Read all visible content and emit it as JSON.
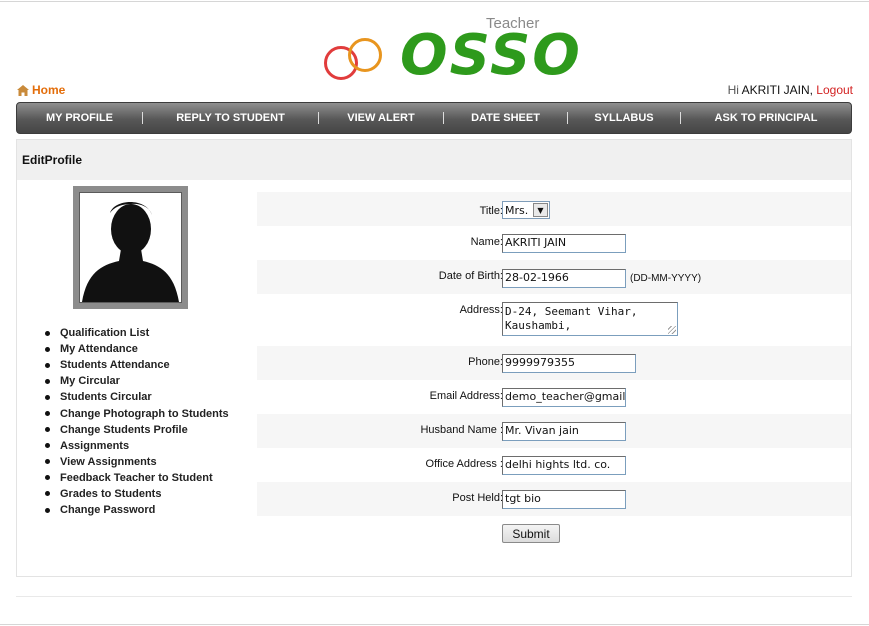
{
  "header": {
    "logo_subtitle": "Teacher",
    "logo_text": "OSSO",
    "home_label": "Home",
    "greeting": "Hi",
    "user_name": "AKRITI JAIN,",
    "logout_label": "Logout"
  },
  "nav": {
    "items": [
      {
        "label": "MY PROFILE"
      },
      {
        "label": "REPLY TO STUDENT"
      },
      {
        "label": "VIEW ALERT"
      },
      {
        "label": "DATE SHEET"
      },
      {
        "label": "SYLLABUS"
      },
      {
        "label": "ASK TO PRINCIPAL"
      }
    ]
  },
  "panel": {
    "title": "EditProfile"
  },
  "sidebar": {
    "items": [
      {
        "label": "Qualification List"
      },
      {
        "label": "My Attendance"
      },
      {
        "label": "Students Attendance"
      },
      {
        "label": "My Circular"
      },
      {
        "label": "Students Circular"
      },
      {
        "label": "Change Photograph to Students"
      },
      {
        "label": "Change Students Profile"
      },
      {
        "label": "Assignments"
      },
      {
        "label": "View Assignments"
      },
      {
        "label": "Feedback Teacher to Student"
      },
      {
        "label": "Grades to Students"
      },
      {
        "label": "Change Password"
      }
    ]
  },
  "form": {
    "title": {
      "label": "Title:",
      "value": "Mrs."
    },
    "name": {
      "label": "Name:",
      "value": "AKRITI JAIN"
    },
    "dob": {
      "label": "Date of Birth:",
      "value": "28-02-1966",
      "hint": "(DD-MM-YYYY)"
    },
    "address": {
      "label": "Address:",
      "line1": "D-24, Seemant Vihar,",
      "line2": "Kaushambi,"
    },
    "phone": {
      "label": "Phone:",
      "value": "9999979355"
    },
    "email": {
      "label": "Email Address:",
      "value": "demo_teacher@gmail"
    },
    "husband": {
      "label": "Husband Name :",
      "value": "Mr. Vivan jain"
    },
    "office": {
      "label": "Office Address :",
      "value": "delhi hights ltd. co."
    },
    "post": {
      "label": "Post Held:",
      "value": "tgt bio"
    },
    "submit_label": "Submit"
  },
  "colors": {
    "accent_orange": "#e36d0a",
    "logout_red": "#d32222",
    "logo_green": "#2e9a1c",
    "nav_bg": "#575757"
  }
}
